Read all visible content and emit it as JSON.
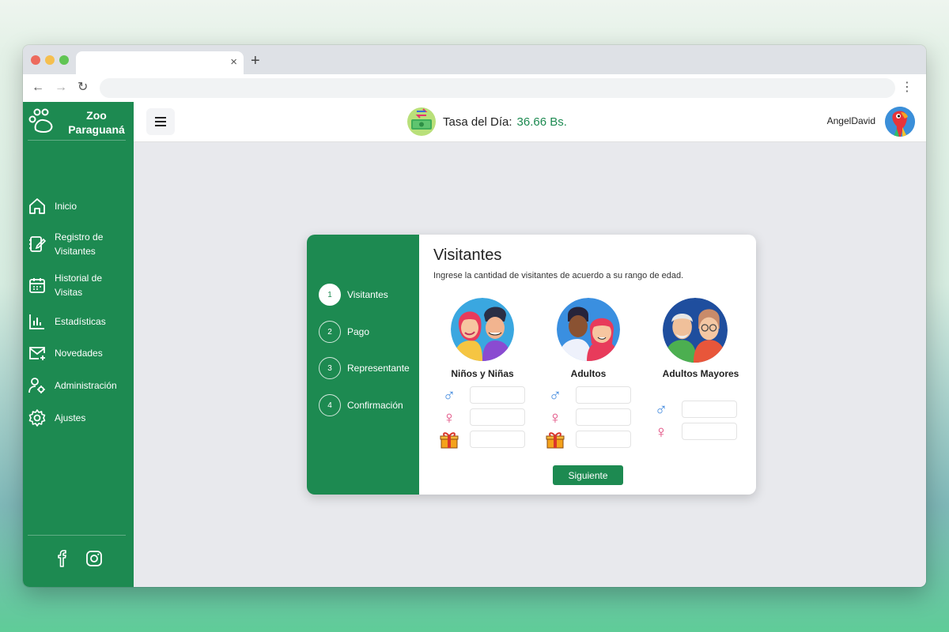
{
  "browser": {
    "tab_close": "×",
    "new_tab": "+",
    "back": "←",
    "forward": "→",
    "reload": "↻",
    "menu": "⋮",
    "traffic_lights": [
      "#ed6a5e",
      "#f5bf4f",
      "#61c554"
    ]
  },
  "brand": {
    "name": "Zoo Paraguaná",
    "color": "#1d8a51"
  },
  "sidebar": {
    "items": [
      {
        "label": "Inicio",
        "icon": "home-icon"
      },
      {
        "label": "Registro de Visitantes",
        "icon": "notebook-edit-icon"
      },
      {
        "label": "Historial de Visitas",
        "icon": "calendar-icon"
      },
      {
        "label": "Estadísticas",
        "icon": "bar-chart-icon"
      },
      {
        "label": "Novedades",
        "icon": "mail-plus-icon"
      },
      {
        "label": "Administración",
        "icon": "user-gear-icon"
      },
      {
        "label": "Ajustes",
        "icon": "gear-icon"
      }
    ],
    "social": [
      "facebook-icon",
      "instagram-icon"
    ]
  },
  "header": {
    "menu_icon": "≡",
    "rate_label": "Tasa del Día:",
    "rate_value": "36.66 Bs.",
    "username": "AngelDavid"
  },
  "wizard": {
    "steps": [
      {
        "number": "1",
        "label": "Visitantes",
        "active": true
      },
      {
        "number": "2",
        "label": "Pago",
        "active": false
      },
      {
        "number": "3",
        "label": "Representante",
        "active": false
      },
      {
        "number": "4",
        "label": "Confirmación",
        "active": false
      }
    ],
    "title": "Visitantes",
    "subtitle": "Ingrese la cantidad de visitantes de acuerdo a su rango de edad.",
    "groups": [
      {
        "label": "Niños y Niñas",
        "fields": [
          "male",
          "female",
          "gift"
        ]
      },
      {
        "label": "Adultos",
        "fields": [
          "male",
          "female",
          "gift"
        ]
      },
      {
        "label": "Adultos Mayores",
        "fields": [
          "male",
          "female"
        ]
      }
    ],
    "symbols": {
      "male": "♂",
      "female": "♀"
    },
    "next_label": "Siguiente"
  }
}
